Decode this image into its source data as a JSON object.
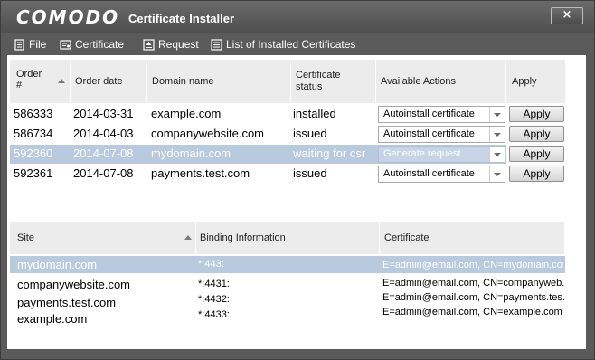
{
  "window": {
    "brand": "COMODO",
    "title": "Certificate Installer",
    "close_glyph": "×"
  },
  "menu": [
    {
      "label": "File",
      "icon": "document-icon"
    },
    {
      "label": "Certificate",
      "icon": "certificate-icon"
    },
    {
      "label": "Request",
      "icon": "request-upload-icon"
    },
    {
      "label": "List of Installed Certificates",
      "icon": "list-icon"
    }
  ],
  "orders": {
    "columns": {
      "order": "Order\n#",
      "date": "Order date",
      "domain": "Domain name",
      "status": "Certificate\nstatus",
      "actions": "Available Actions",
      "apply": "Apply"
    },
    "rows": [
      {
        "order": "586333",
        "date": "2014-03-31",
        "domain": "example.com",
        "status": "installed",
        "action": "Autoinstall certificate",
        "apply": "Apply",
        "selected": false
      },
      {
        "order": "586734",
        "date": "2014-04-03",
        "domain": "companywebsite.com",
        "status": "issued",
        "action": "Autoinstall certificate",
        "apply": "Apply",
        "selected": false
      },
      {
        "order": "592360",
        "date": "2014-07-08",
        "domain": "mydomain.com",
        "status": "waiting for csr",
        "action": "Generate request",
        "apply": "Apply",
        "selected": true
      },
      {
        "order": "592361",
        "date": "2014-07-08",
        "domain": "payments.test.com",
        "status": "issued",
        "action": "Autoinstall certificate",
        "apply": "Apply",
        "selected": false
      }
    ]
  },
  "sites": {
    "columns": {
      "site": "Site",
      "binding": "Binding Information",
      "certificate": "Certificate"
    },
    "rows": [
      {
        "site": "mydomain.com",
        "binding": "*:443:",
        "certificate": "E=admin@email.com, CN=mydomain.com",
        "selected": true
      },
      {
        "site": "companywebsite.com",
        "binding": "*:4431:",
        "certificate": "E=admin@email.com, CN=companyweb...",
        "selected": false
      },
      {
        "site": "payments.test.com",
        "binding": "*:4432:",
        "certificate": "E=admin@email.com, CN=payments.tes...",
        "selected": false
      },
      {
        "site": "example.com",
        "binding": "*:4433:",
        "certificate": "E=admin@email.com, CN=example.com",
        "selected": false
      }
    ]
  },
  "colors": {
    "window_bg": "#5a5a5a",
    "selection": "#b9c9de",
    "header_bg": "#ececec"
  }
}
